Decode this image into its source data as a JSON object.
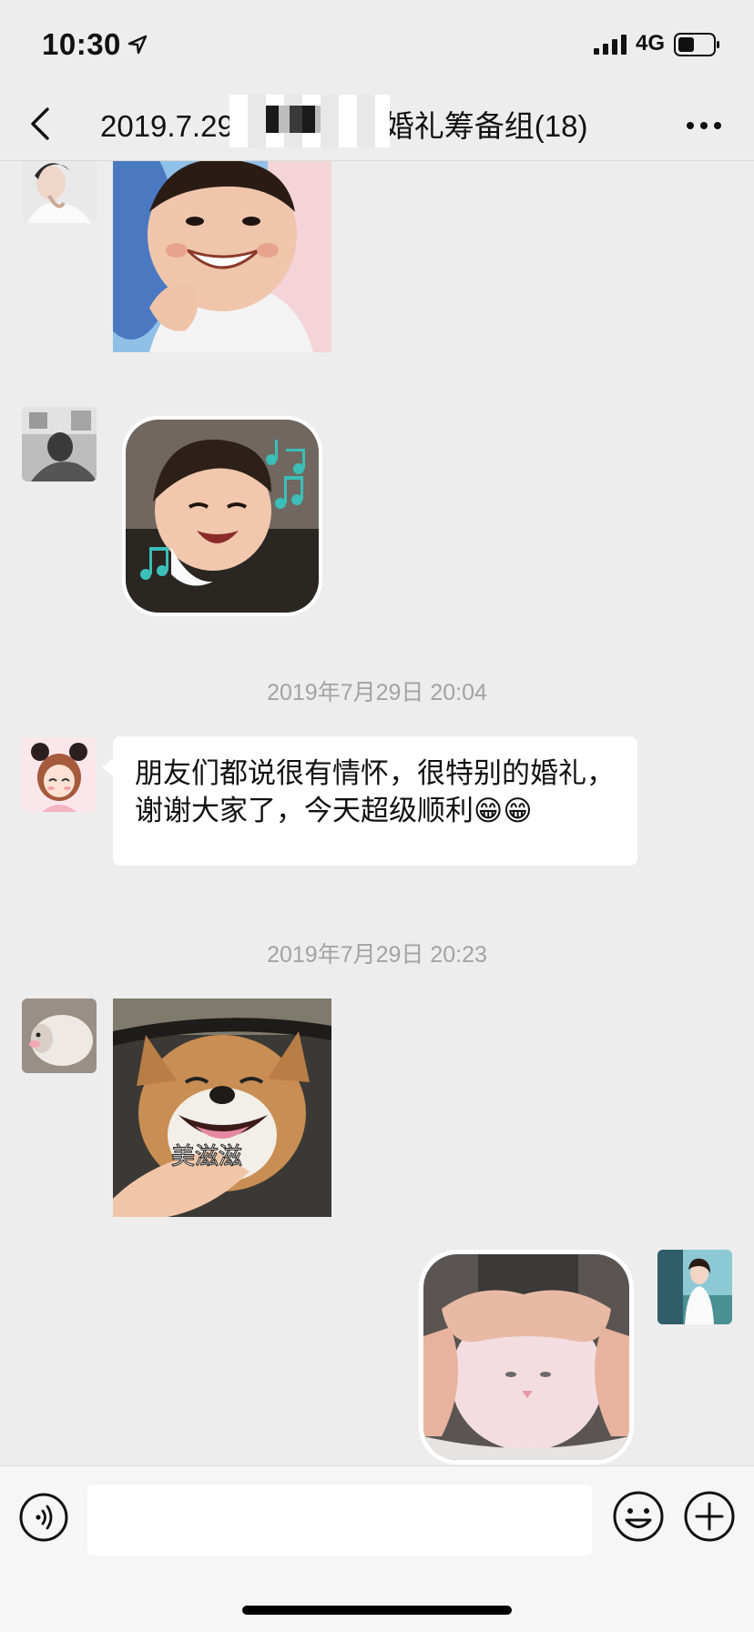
{
  "status_bar": {
    "time": "10:30",
    "network": "4G"
  },
  "nav": {
    "title": "2019.7.29赵某某许愈婚礼筹备组(18)"
  },
  "messages": {
    "timestamp_1": "2019年7月29日 20:04",
    "text_1": "朋友们都说很有情怀，很特别的婚礼，谢谢大家了，今天超级顺利😁😁",
    "timestamp_2": "2019年7月29日 20:23",
    "sticker_caption": "美滋滋"
  },
  "input": {
    "value": ""
  },
  "icons": {
    "back": "chevron-left-icon",
    "more": "more-dots-icon",
    "voice": "voice-icon",
    "emoji": "emoji-icon",
    "plus": "plus-icon"
  },
  "colors": {
    "background": "#ededed",
    "bubble": "#ffffff",
    "timestamp": "#a3a3a3"
  }
}
